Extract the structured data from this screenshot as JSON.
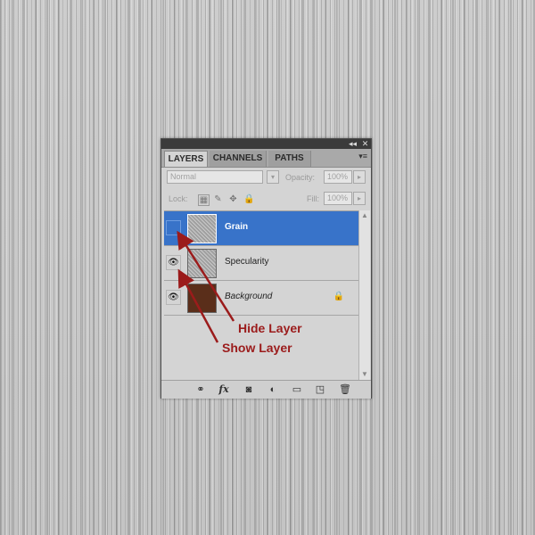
{
  "panel": {
    "tabs": [
      {
        "label": "LAYERS"
      },
      {
        "label": "CHANNELS"
      },
      {
        "label": "PATHS"
      }
    ],
    "titlebar": {
      "collapse_glyph": "◂◂",
      "close_glyph": "✕"
    },
    "menu_glyph": "▾≡",
    "blend_mode": "Normal",
    "opacity_label": "Opacity:",
    "opacity_value": "100%",
    "lock_label": "Lock:",
    "fill_label": "Fill:",
    "fill_value": "100%",
    "layers": [
      {
        "name": "Grain",
        "visible": false,
        "selected": true,
        "thumbnail": "noise-texture",
        "italic": false,
        "locked": false
      },
      {
        "name": "Specularity",
        "visible": true,
        "selected": false,
        "thumbnail": "noise-texture",
        "italic": false,
        "locked": false
      },
      {
        "name": "Background",
        "visible": true,
        "selected": false,
        "thumbnail": "brown-fill",
        "italic": true,
        "locked": true
      }
    ],
    "footer_icons": [
      "link-icon",
      "fx-icon",
      "mask-icon",
      "adjustment-icon",
      "folder-icon",
      "new-layer-icon",
      "trash-icon"
    ],
    "fx_label": "fx"
  },
  "annotations": {
    "hide_layer": "Hide Layer",
    "show_layer": "Show Layer"
  },
  "colors": {
    "selected_row": "#3873c9",
    "annotation": "#9b1b1b",
    "background_thumb": "#5a2e1a"
  }
}
